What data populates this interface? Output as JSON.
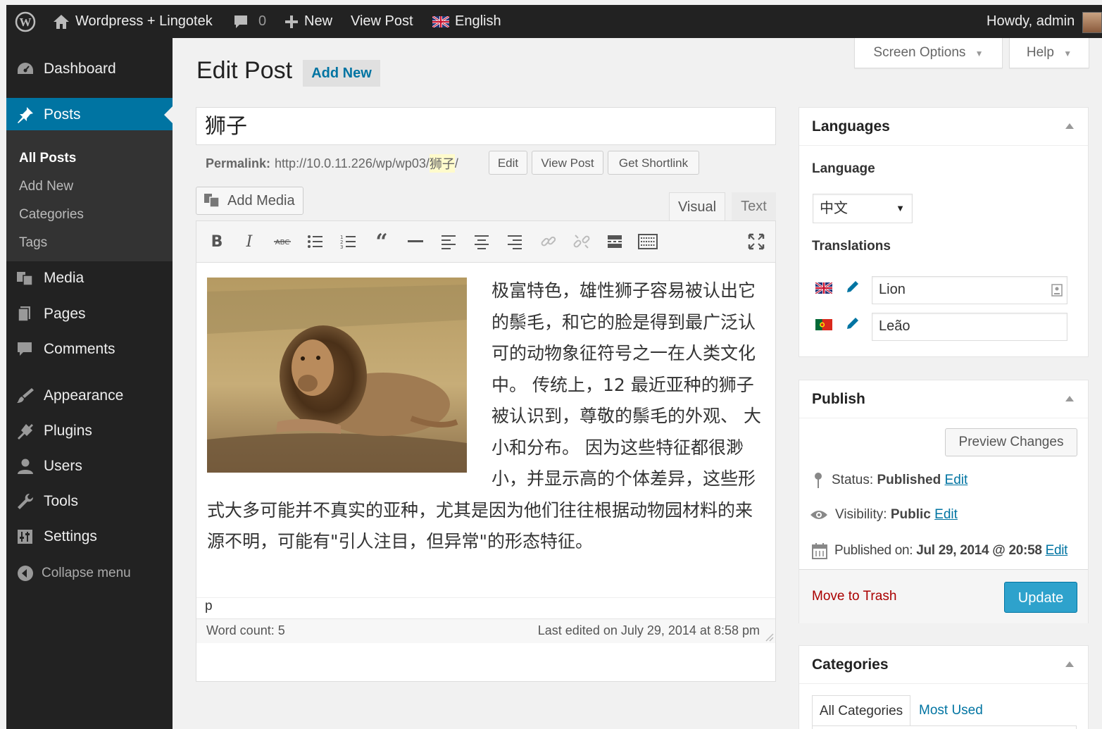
{
  "adminbar": {
    "site_name": "Wordpress + Lingotek",
    "comments_count": "0",
    "new_label": "New",
    "view_post_label": "View Post",
    "language_label": "English",
    "howdy": "Howdy, admin"
  },
  "sidebar": {
    "dashboard": "Dashboard",
    "posts": "Posts",
    "submenu": [
      "All Posts",
      "Add New",
      "Categories",
      "Tags"
    ],
    "media": "Media",
    "pages": "Pages",
    "comments": "Comments",
    "appearance": "Appearance",
    "plugins": "Plugins",
    "users": "Users",
    "tools": "Tools",
    "settings": "Settings",
    "collapse": "Collapse menu"
  },
  "header": {
    "title": "Edit Post",
    "add_new": "Add New",
    "screen_options": "Screen Options",
    "help": "Help"
  },
  "post": {
    "title": "狮子",
    "permalink_label": "Permalink:",
    "permalink_base": "http://10.0.11.226/wp/wp03/",
    "permalink_slug": "狮子",
    "permalink_end": "/",
    "edit_btn": "Edit",
    "view_post_btn": "View Post",
    "shortlink_btn": "Get Shortlink",
    "add_media": "Add Media",
    "tab_visual": "Visual",
    "tab_text": "Text",
    "content": "极富特色，雄性狮子容易被认出它的鬃毛，和它的脸是得到最广泛认可的动物象征符号之一在人类文化中。 传统上，12 最近亚种的狮子被认识到，尊敬的鬃毛的外观、 大小和分布。 因为这些特征都很渺小，并显示高的个体差异，这些形式大多可能并不真实的亚种，尤其是因为他们往往根据动物园材料的来源不明，可能有\"引人注目，但异常\"的形态特征。",
    "path": "p",
    "word_count": "Word count: 5",
    "last_edited": "Last edited on July 29, 2014 at 8:58 pm"
  },
  "languages_box": {
    "title": "Languages",
    "language_label": "Language",
    "language_value": "中文",
    "translations_label": "Translations",
    "translation_en": "Lion",
    "translation_pt": "Leão"
  },
  "publish_box": {
    "title": "Publish",
    "preview": "Preview Changes",
    "status_label": "Status:",
    "status_value": "Published",
    "visibility_label": "Visibility:",
    "visibility_value": "Public",
    "published_label": "Published on:",
    "published_value": "Jul 29, 2014 @ 20:58",
    "edit_link": "Edit",
    "trash": "Move to Trash",
    "update": "Update"
  },
  "categories_box": {
    "title": "Categories",
    "tab_all": "All Categories",
    "tab_most_used": "Most Used"
  },
  "colors": {
    "accent": "#0074a2",
    "update_button": "#2ea2cc",
    "trash": "#aa0000",
    "sidebar_bg": "#222222",
    "adminbar_bg": "#222222"
  }
}
